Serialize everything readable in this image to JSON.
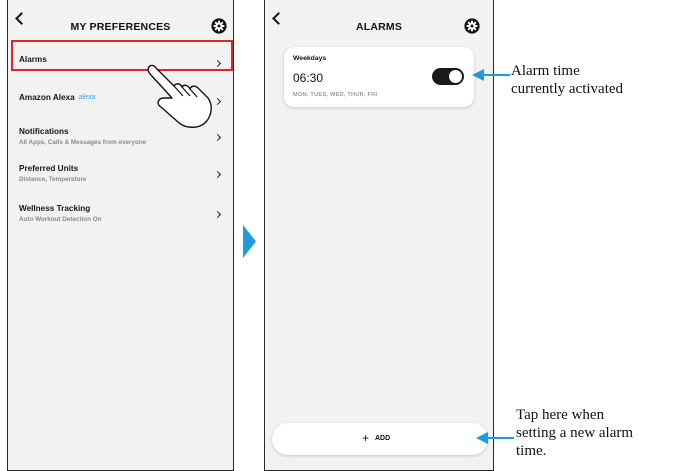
{
  "left_screen": {
    "title": "MY PREFERENCES",
    "items": [
      {
        "title": "Alarms",
        "subtitle": ""
      },
      {
        "title": "Amazon Alexa",
        "subtitle": "",
        "logo_text": "alexa"
      },
      {
        "title": "Notifications",
        "subtitle": "All Apps, Calls & Messages from everyone"
      },
      {
        "title": "Preferred Units",
        "subtitle": "Distance, Temperature"
      },
      {
        "title": "Wellness Tracking",
        "subtitle": "Auto Workout Detection On"
      }
    ]
  },
  "right_screen": {
    "title": "ALARMS",
    "alarm": {
      "label": "Weekdays",
      "time": "06:30",
      "days": "MON, TUES, WED, THUR, FRI",
      "enabled": true
    },
    "add_button": {
      "icon": "+",
      "label": "ADD"
    }
  },
  "callouts": {
    "alarm_activated_line1": "Alarm time",
    "alarm_activated_line2": "currently activated",
    "add_line1": "Tap here when",
    "add_line2": "setting a new alarm",
    "add_line3": "time."
  },
  "colors": {
    "highlight": "#e0252b",
    "accent": "#1e9bd8",
    "alexa": "#2aa8e0",
    "toggle": "#1a1a1a"
  },
  "icons": [
    "back-icon",
    "gear-icon",
    "chevron-right-icon",
    "hand-pointer-icon",
    "arrow-right-icon"
  ]
}
